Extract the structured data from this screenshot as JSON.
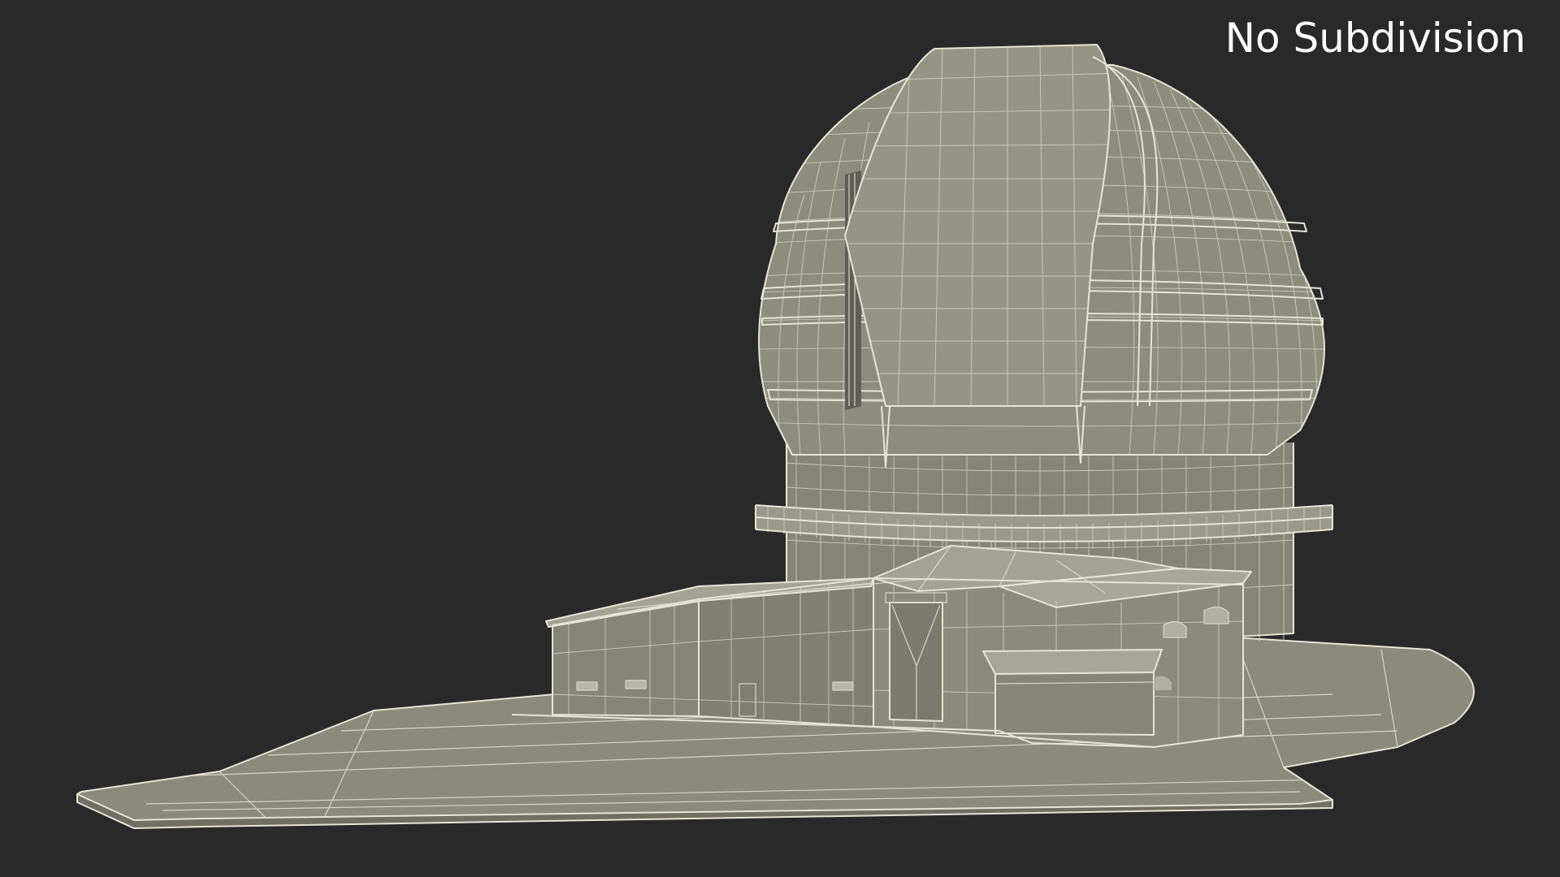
{
  "caption": "No Subdivision",
  "scene": {
    "subject": "observatory-dome-model",
    "display_mode": "wireframe-on-shaded",
    "colors": {
      "background": "#292929",
      "surface": "#8a8a7d",
      "surface_light": "#9a9a8c",
      "surface_dark": "#6f6f63",
      "wire": "#e6e4d6",
      "caption": "#ffffff"
    }
  }
}
